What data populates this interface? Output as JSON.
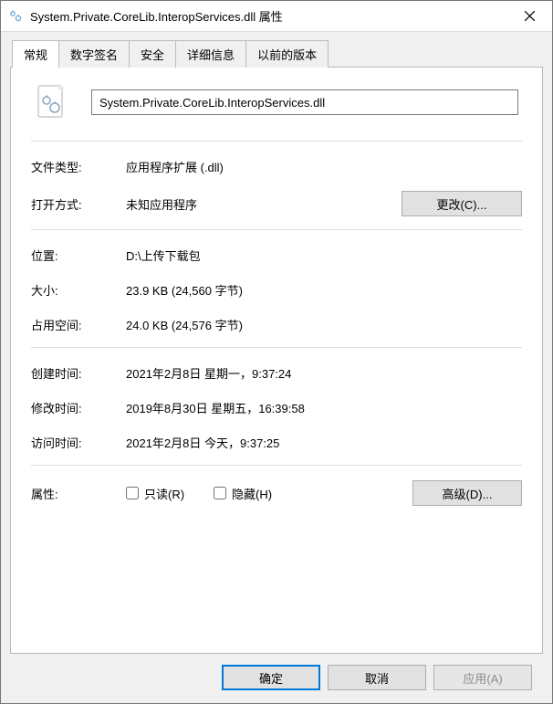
{
  "window": {
    "title": "System.Private.CoreLib.InteropServices.dll 属性"
  },
  "tabs": {
    "general": "常规",
    "signatures": "数字签名",
    "security": "安全",
    "details": "详细信息",
    "previous": "以前的版本"
  },
  "general": {
    "filename": "System.Private.CoreLib.InteropServices.dll",
    "filetype_label": "文件类型:",
    "filetype_value": "应用程序扩展 (.dll)",
    "openwith_label": "打开方式:",
    "openwith_value": "未知应用程序",
    "change_btn": "更改(C)...",
    "location_label": "位置:",
    "location_value": "D:\\上传下载包",
    "size_label": "大小:",
    "size_value": "23.9 KB (24,560 字节)",
    "sizeondisk_label": "占用空间:",
    "sizeondisk_value": "24.0 KB (24,576 字节)",
    "created_label": "创建时间:",
    "created_value": "2021年2月8日 星期一，9:37:24",
    "modified_label": "修改时间:",
    "modified_value": "2019年8月30日 星期五，16:39:58",
    "accessed_label": "访问时间:",
    "accessed_value": "2021年2月8日 今天，9:37:25",
    "attributes_label": "属性:",
    "readonly_label": "只读(R)",
    "hidden_label": "隐藏(H)",
    "advanced_btn": "高级(D)..."
  },
  "footer": {
    "ok": "确定",
    "cancel": "取消",
    "apply": "应用(A)"
  }
}
